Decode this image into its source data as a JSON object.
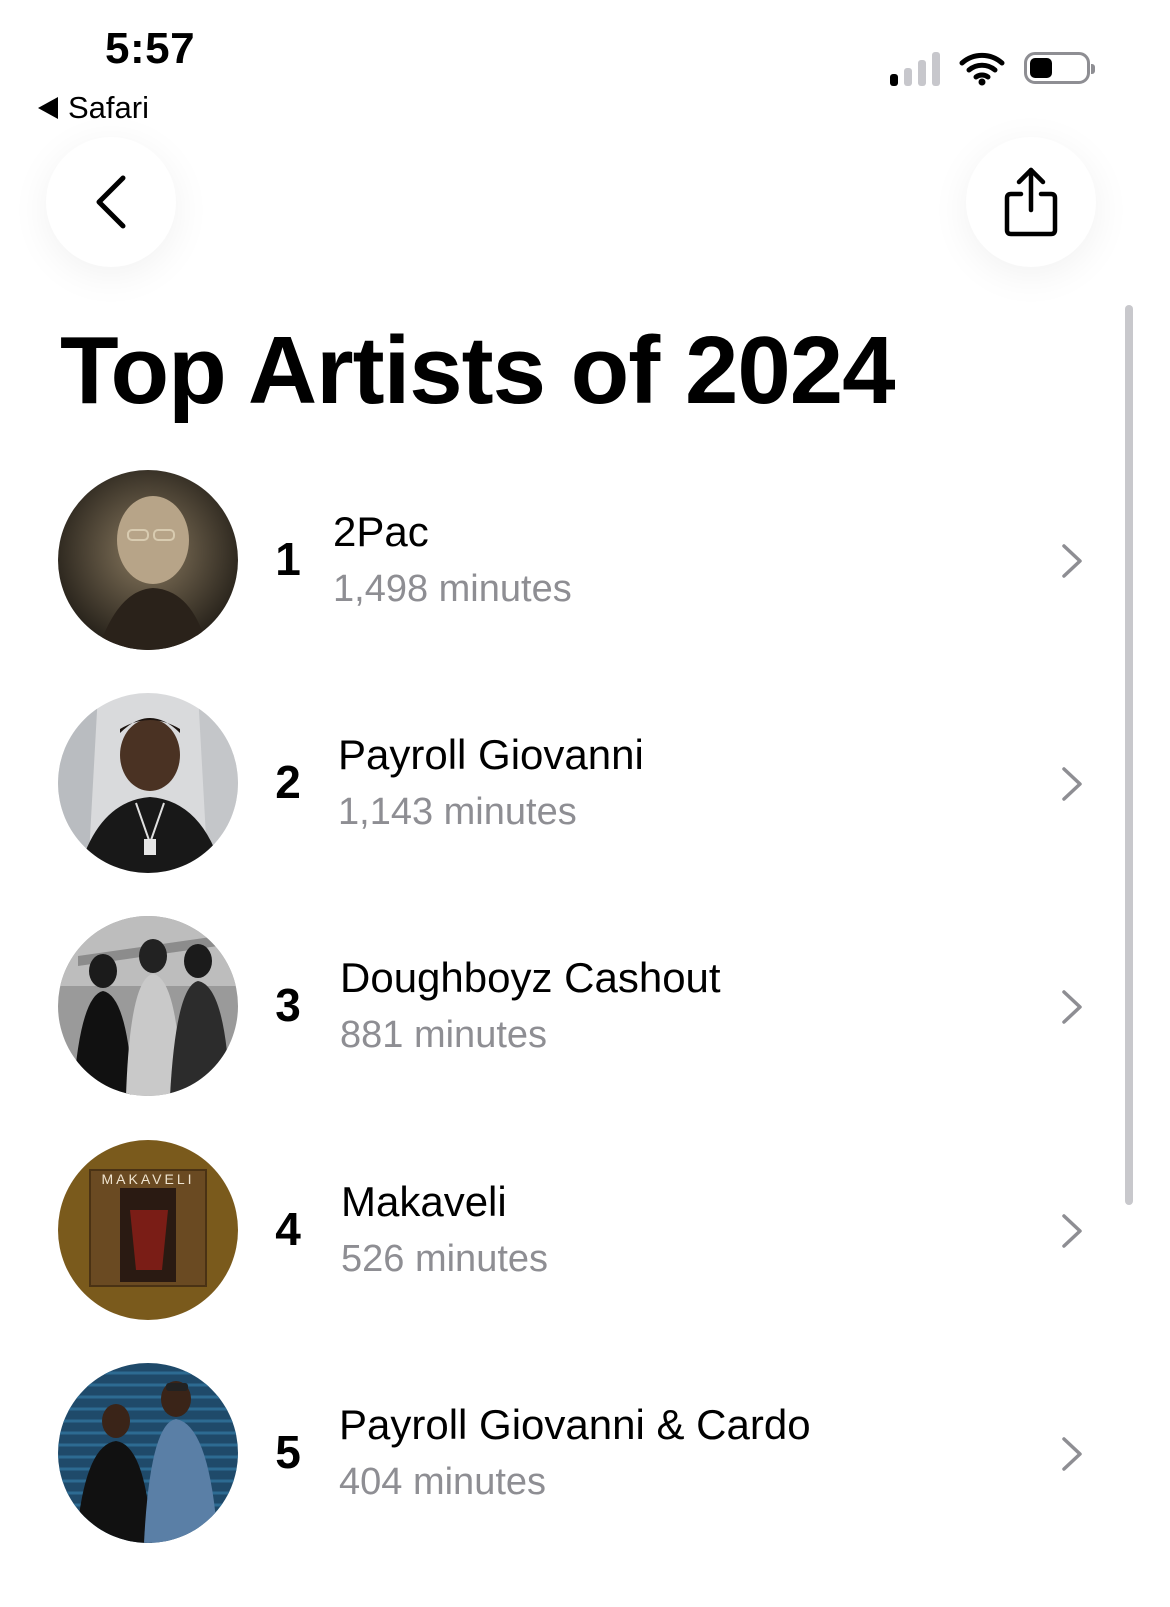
{
  "status_bar": {
    "time": "5:57",
    "back_app": "Safari"
  },
  "page": {
    "title": "Top Artists of 2024"
  },
  "artists": [
    {
      "rank": "1",
      "name": "2Pac",
      "minutes": "1,498 minutes"
    },
    {
      "rank": "2",
      "name": "Payroll Giovanni",
      "minutes": "1,143 minutes"
    },
    {
      "rank": "3",
      "name": "Doughboyz Cashout",
      "minutes": "881 minutes"
    },
    {
      "rank": "4",
      "name": "Makaveli",
      "minutes": "526 minutes",
      "album_text": "MAKAVELI"
    },
    {
      "rank": "5",
      "name": "Payroll Giovanni & Cardo",
      "minutes": "404 minutes"
    }
  ],
  "icons": {
    "back": "chevron-left-icon",
    "share": "share-icon",
    "row_chevron": "chevron-right-icon"
  },
  "colors": {
    "secondary_text": "#8e8e93",
    "makaveli_bg": "#7a5a1c"
  }
}
